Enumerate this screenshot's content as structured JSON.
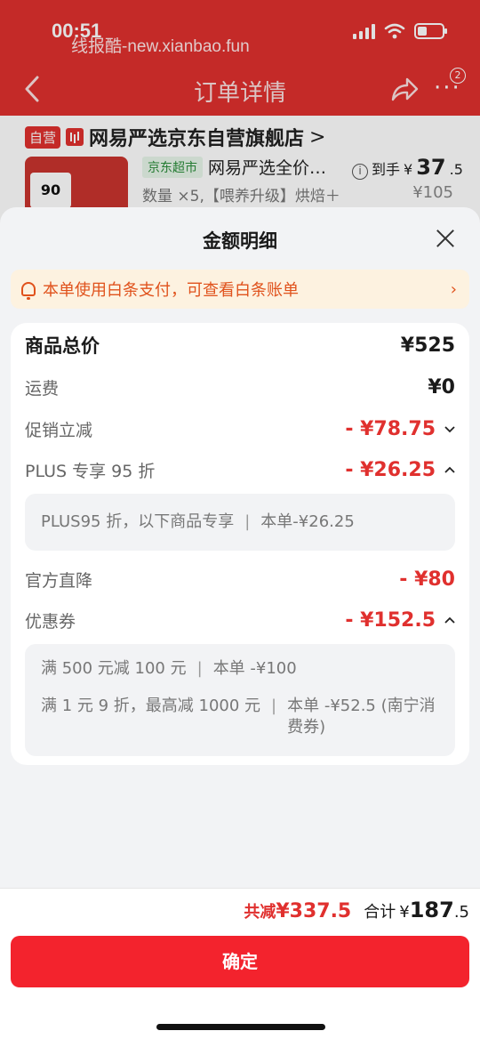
{
  "status_bar": {
    "time": "00:51",
    "watermark": "线报酷-new.xianbao.fun"
  },
  "nav": {
    "title": "订单详情",
    "badge": "2"
  },
  "order": {
    "self_tag": "自营",
    "shop_name": "网易严选京东自营旗舰店",
    "shop_arrow": ">",
    "product_image_text": "90",
    "jd_tag": "京东超市",
    "product_name": "网易严选全价…",
    "product_spec": "数量 ×5,【喂养升级】烘焙＋",
    "price_label": "到手",
    "price_currency": "¥",
    "price_main": "37",
    "price_sub": ".5",
    "original_price": "¥105"
  },
  "sheet": {
    "title": "金额明细",
    "notice": "本单使用白条支付，可查看白条账单",
    "notice_arrow": "›",
    "rows": {
      "total": {
        "label": "商品总价",
        "value": "¥525"
      },
      "shipping": {
        "label": "运费",
        "value": "¥0"
      },
      "promo": {
        "label": "促销立减",
        "value": "- ¥78.75"
      },
      "plus": {
        "label": "PLUS 专享 95 折",
        "value": "- ¥26.25"
      },
      "official": {
        "label": "官方直降",
        "value": "- ¥80"
      },
      "coupon": {
        "label": "优惠券",
        "value": "- ¥152.5"
      }
    },
    "plus_detail": {
      "left": "PLUS95 折，以下商品专享",
      "sep": "|",
      "right": "本单-¥26.25"
    },
    "coupon_details": [
      {
        "left": "满 500 元减 100 元",
        "sep": "|",
        "right": "本单 -¥100"
      },
      {
        "left": "满 1 元 9 折，最高减 1000 元",
        "sep": "|",
        "right": "本单 -¥52.5 (南宁消费券)"
      }
    ]
  },
  "footer": {
    "saved_label": "共减",
    "saved_value": "¥337.5",
    "total_label": "合计",
    "total_currency": "¥",
    "total_main": "187",
    "total_sub": ".5",
    "confirm_label": "确定"
  },
  "colors": {
    "accent_red": "#e0302e",
    "button_red": "#f3232d",
    "notice_orange": "#e0521c",
    "notice_bg": "#fdf2e0"
  },
  "icons": [
    "back-icon",
    "share-icon",
    "more-icon",
    "close-icon",
    "bell-icon",
    "chevron-down-icon",
    "chevron-up-icon",
    "info-icon"
  ]
}
